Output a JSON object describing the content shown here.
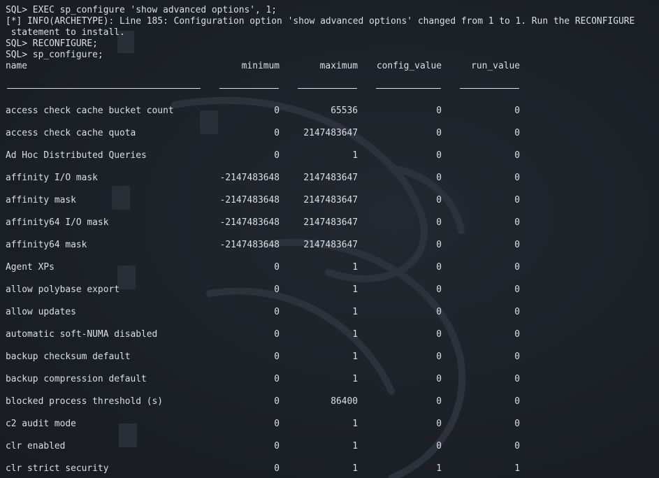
{
  "console": {
    "lines": [
      "SQL> EXEC sp_configure 'show advanced options', 1;",
      "[*] INFO(ARCHETYPE): Line 185: Configuration option 'show advanced options' changed from 1 to 1. Run the RECONFIGURE",
      " statement to install.",
      "SQL> RECONFIGURE;",
      "SQL> sp_configure;"
    ]
  },
  "table": {
    "headers": {
      "name": "name",
      "minimum": "minimum",
      "maximum": "maximum",
      "config_value": "config_value",
      "run_value": "run_value"
    },
    "rows": [
      {
        "name": "access check cache bucket count",
        "minimum": "0",
        "maximum": "65536",
        "config_value": "0",
        "run_value": "0"
      },
      {
        "name": "access check cache quota",
        "minimum": "0",
        "maximum": "2147483647",
        "config_value": "0",
        "run_value": "0"
      },
      {
        "name": "Ad Hoc Distributed Queries",
        "minimum": "0",
        "maximum": "1",
        "config_value": "0",
        "run_value": "0"
      },
      {
        "name": "affinity I/O mask",
        "minimum": "-2147483648",
        "maximum": "2147483647",
        "config_value": "0",
        "run_value": "0"
      },
      {
        "name": "affinity mask",
        "minimum": "-2147483648",
        "maximum": "2147483647",
        "config_value": "0",
        "run_value": "0"
      },
      {
        "name": "affinity64 I/O mask",
        "minimum": "-2147483648",
        "maximum": "2147483647",
        "config_value": "0",
        "run_value": "0"
      },
      {
        "name": "affinity64 mask",
        "minimum": "-2147483648",
        "maximum": "2147483647",
        "config_value": "0",
        "run_value": "0"
      },
      {
        "name": "Agent XPs",
        "minimum": "0",
        "maximum": "1",
        "config_value": "0",
        "run_value": "0"
      },
      {
        "name": "allow polybase export",
        "minimum": "0",
        "maximum": "1",
        "config_value": "0",
        "run_value": "0"
      },
      {
        "name": "allow updates",
        "minimum": "0",
        "maximum": "1",
        "config_value": "0",
        "run_value": "0"
      },
      {
        "name": "automatic soft-NUMA disabled",
        "minimum": "0",
        "maximum": "1",
        "config_value": "0",
        "run_value": "0"
      },
      {
        "name": "backup checksum default",
        "minimum": "0",
        "maximum": "1",
        "config_value": "0",
        "run_value": "0"
      },
      {
        "name": "backup compression default",
        "minimum": "0",
        "maximum": "1",
        "config_value": "0",
        "run_value": "0"
      },
      {
        "name": "blocked process threshold (s)",
        "minimum": "0",
        "maximum": "86400",
        "config_value": "0",
        "run_value": "0"
      },
      {
        "name": "c2 audit mode",
        "minimum": "0",
        "maximum": "1",
        "config_value": "0",
        "run_value": "0"
      },
      {
        "name": "clr enabled",
        "minimum": "0",
        "maximum": "1",
        "config_value": "0",
        "run_value": "0"
      },
      {
        "name": "clr strict security",
        "minimum": "0",
        "maximum": "1",
        "config_value": "1",
        "run_value": "1"
      }
    ]
  },
  "colors": {
    "background": "#1c2027",
    "text": "#dcdfe4"
  }
}
